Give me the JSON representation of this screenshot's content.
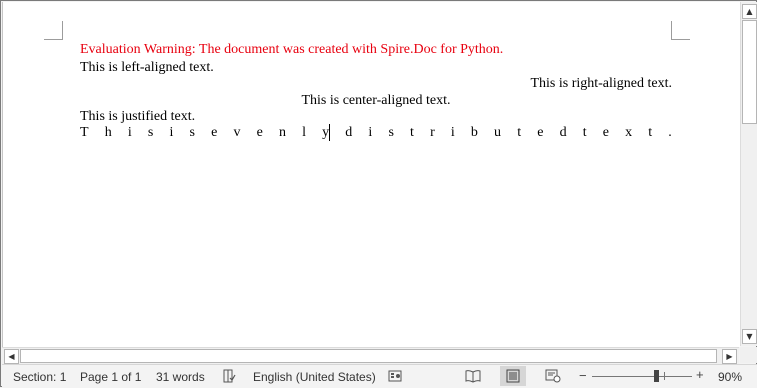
{
  "document": {
    "lines": [
      "Evaluation Warning: The document was created with Spire.Doc for Python.",
      "This is left-aligned text.",
      "This is right-aligned text.",
      "This is center-aligned text.",
      "This is justified text."
    ],
    "distributed_chars": [
      "T",
      "h",
      "i",
      "s",
      "i",
      "s",
      "e",
      "v",
      "e",
      "n",
      "l",
      "y",
      "d",
      "i",
      "s",
      "t",
      "r",
      "i",
      "b",
      "u",
      "t",
      "e",
      "d",
      "t",
      "e",
      "x",
      "t",
      "."
    ],
    "warning_color": "#e8000f"
  },
  "scrollbars": {
    "up_arrow": "▲",
    "down_arrow": "▼",
    "left_arrow": "◀",
    "right_arrow": "▶"
  },
  "status_bar": {
    "section": "Section: 1",
    "page": "Page 1 of 1",
    "words": "31 words",
    "language": "English (United States)",
    "zoom_out": "−",
    "zoom_in": "+",
    "zoom": "90%",
    "zoom_level_percent": 90
  },
  "icons": {
    "proofing": "proofing-check-icon",
    "macro": "macro-recording-icon",
    "read_mode": "read-mode-icon",
    "print_layout": "print-layout-icon",
    "web_layout": "web-layout-icon"
  }
}
